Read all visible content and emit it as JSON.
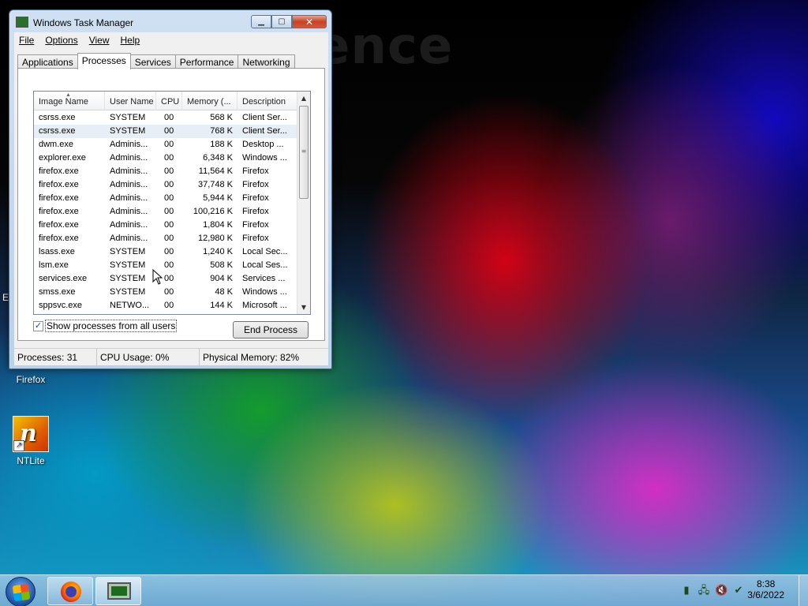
{
  "wallpaper": {
    "brand_text": "ence"
  },
  "desktop": {
    "edge_letter": "E",
    "icons": [
      {
        "label": "Firefox"
      },
      {
        "label": "NTLite"
      }
    ]
  },
  "window": {
    "title": "Windows Task Manager",
    "menu": [
      "File",
      "Options",
      "View",
      "Help"
    ],
    "tabs": [
      "Applications",
      "Processes",
      "Services",
      "Performance",
      "Networking"
    ],
    "active_tab": "Processes",
    "columns": [
      "Image Name",
      "User Name",
      "CPU",
      "Memory (...",
      "Description"
    ],
    "rows": [
      {
        "image": "csrss.exe",
        "user": "SYSTEM",
        "cpu": "00",
        "memory": "568 K",
        "desc": "Client Ser..."
      },
      {
        "image": "csrss.exe",
        "user": "SYSTEM",
        "cpu": "00",
        "memory": "768 K",
        "desc": "Client Ser..."
      },
      {
        "image": "dwm.exe",
        "user": "Adminis...",
        "cpu": "00",
        "memory": "188 K",
        "desc": "Desktop ..."
      },
      {
        "image": "explorer.exe",
        "user": "Adminis...",
        "cpu": "00",
        "memory": "6,348 K",
        "desc": "Windows ..."
      },
      {
        "image": "firefox.exe",
        "user": "Adminis...",
        "cpu": "00",
        "memory": "11,564 K",
        "desc": "Firefox"
      },
      {
        "image": "firefox.exe",
        "user": "Adminis...",
        "cpu": "00",
        "memory": "37,748 K",
        "desc": "Firefox"
      },
      {
        "image": "firefox.exe",
        "user": "Adminis...",
        "cpu": "00",
        "memory": "5,944 K",
        "desc": "Firefox"
      },
      {
        "image": "firefox.exe",
        "user": "Adminis...",
        "cpu": "00",
        "memory": "100,216 K",
        "desc": "Firefox"
      },
      {
        "image": "firefox.exe",
        "user": "Adminis...",
        "cpu": "00",
        "memory": "1,804 K",
        "desc": "Firefox"
      },
      {
        "image": "firefox.exe",
        "user": "Adminis...",
        "cpu": "00",
        "memory": "12,980 K",
        "desc": "Firefox"
      },
      {
        "image": "lsass.exe",
        "user": "SYSTEM",
        "cpu": "00",
        "memory": "1,240 K",
        "desc": "Local Sec..."
      },
      {
        "image": "lsm.exe",
        "user": "SYSTEM",
        "cpu": "00",
        "memory": "508 K",
        "desc": "Local Ses..."
      },
      {
        "image": "services.exe",
        "user": "SYSTEM",
        "cpu": "00",
        "memory": "904 K",
        "desc": "Services ..."
      },
      {
        "image": "smss.exe",
        "user": "SYSTEM",
        "cpu": "00",
        "memory": "48 K",
        "desc": "Windows ..."
      },
      {
        "image": "sppsvc.exe",
        "user": "NETWO...",
        "cpu": "00",
        "memory": "144 K",
        "desc": "Microsoft ..."
      }
    ],
    "show_all_label": "Show processes from all users",
    "show_all_checked": true,
    "end_process_label": "End Process",
    "status": {
      "processes": "Processes: 31",
      "cpu": "CPU Usage: 0%",
      "memory": "Physical Memory: 82%"
    }
  },
  "taskbar": {
    "clock_time": "8:38",
    "clock_date": "3/6/2022"
  }
}
